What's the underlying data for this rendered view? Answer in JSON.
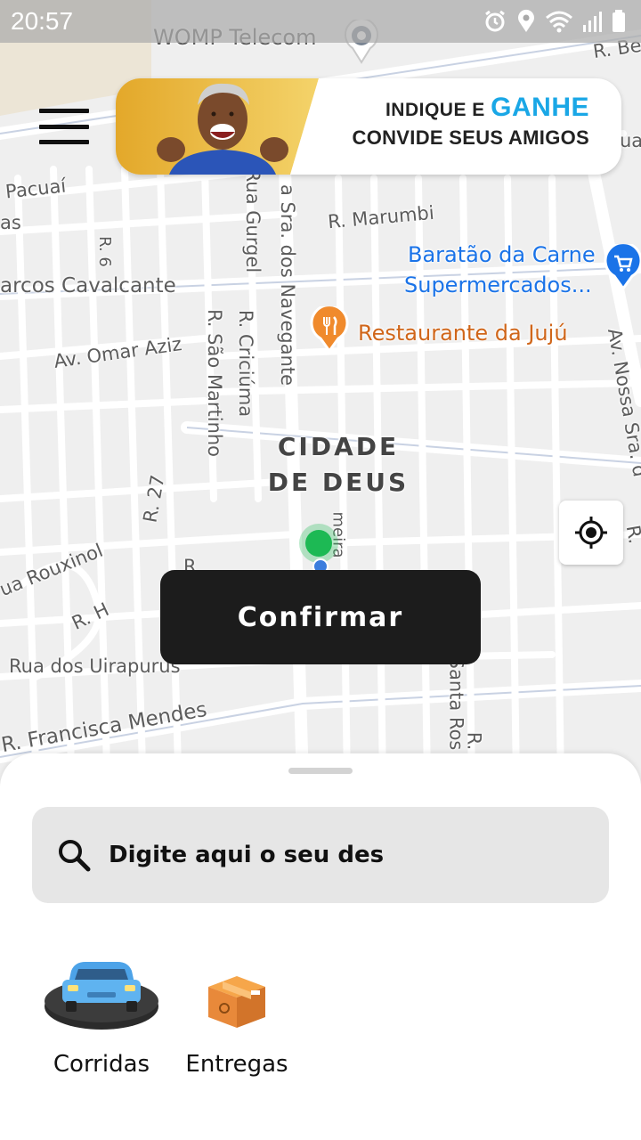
{
  "status_bar": {
    "time": "20:57",
    "icons": [
      "alarm-icon",
      "location-icon",
      "wifi-icon",
      "signal-icon",
      "battery-icon"
    ]
  },
  "map": {
    "labels": {
      "womp": "WOMP Telecom",
      "r_bei": "R. Bei",
      "ua": "ua",
      "pacuai": "Pacuaí",
      "as": "as",
      "r6": "R. 6",
      "rua_gurgel": "Rua Gurgel",
      "sra_navegante": "a Sra. dos Navegante",
      "r_marumbi": "R. Marumbi",
      "baratao": "Baratão da Carne",
      "supermercados": "Supermercados...",
      "marcos": "arcos Cavalcante",
      "restaurante": "Restaurante da Jujú",
      "av_omar": "Av. Omar Aziz",
      "r_sao_martinho": "R. São Martinho",
      "r_criciuma": "R. Criciúma",
      "av_nossa": "Av. Nossa Sra. d",
      "district_1": "CIDADE",
      "district_2": "DE DEUS",
      "r27": "R. 27",
      "r_right": "R.",
      "rouxino": "ua Rouxinol",
      "r_small": "R",
      "rh": "R. H",
      "meira": "meira",
      "uirapurus": "Rua dos Uirapurus",
      "santa_ros": "Santa Ros",
      "francisca": "R. Francisca Mendes",
      "r_bottom": "R."
    }
  },
  "promo": {
    "line1_prefix": "INDIQUE E ",
    "line1_accent": "GANHE",
    "line2": "CONVIDE SEUS AMIGOS"
  },
  "confirm_label": "Confirmar",
  "search": {
    "text": "Digite aqui o seu des"
  },
  "services": [
    {
      "label": "Corridas",
      "icon": "car-icon"
    },
    {
      "label": "Entregas",
      "icon": "package-icon"
    }
  ],
  "colors": {
    "accent": "#1aa7e6",
    "confirm_bg": "#1c1c1c",
    "pin_green": "#1db954",
    "poi_blue": "#1a73e8",
    "poi_orange": "#f08a2c"
  }
}
